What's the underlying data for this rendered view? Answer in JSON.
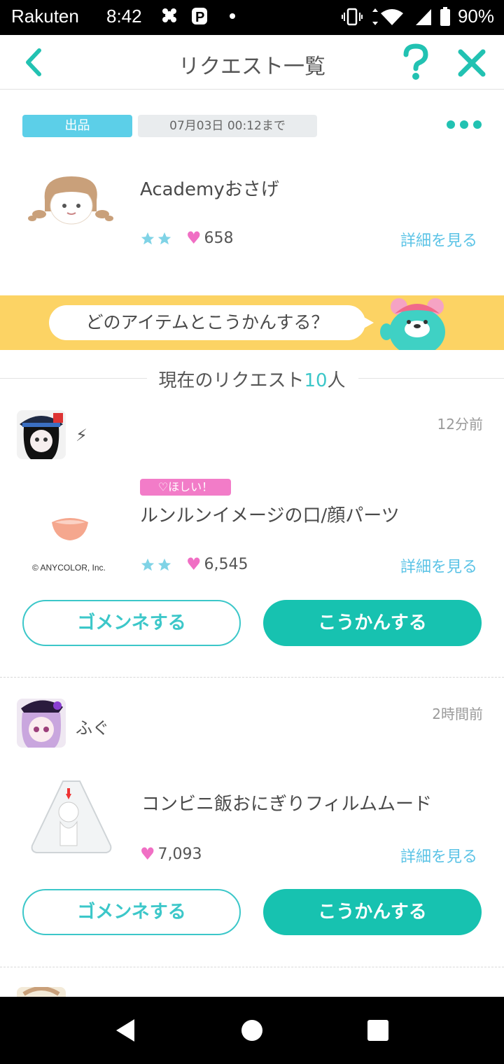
{
  "status_bar": {
    "carrier": "Rakuten",
    "time": "8:42",
    "notification_icons": [
      "flower-icon",
      "p-icon",
      "dot-icon"
    ],
    "battery": "90%"
  },
  "header": {
    "title": "リクエスト一覧"
  },
  "listing": {
    "tag": "出品",
    "deadline": "07月03日 00:12まで",
    "item_name": "Academyおさげ",
    "stars": 2,
    "likes": "658",
    "detail_label": "詳細を見る"
  },
  "banner": {
    "text": "どのアイテムとこうかんする？"
  },
  "requests_heading": {
    "prefix": "現在のリクエスト",
    "count": "10",
    "suffix": "人"
  },
  "requests": [
    {
      "username": "⚡",
      "time_ago": "12分前",
      "badge": "♡ほしい！",
      "item_name": "ルンルンイメージの口/顔パーツ",
      "stars": 2,
      "likes": "6,545",
      "copyright": "© ANYCOLOR, Inc.",
      "detail_label": "詳細を見る",
      "decline_label": "ゴメンネする",
      "accept_label": "こうかんする"
    },
    {
      "username": "ふぐ",
      "time_ago": "2時間前",
      "item_name": "コンビニ飯おにぎりフィルムムード",
      "likes": "7,093",
      "detail_label": "詳細を見る",
      "decline_label": "ゴメンネする",
      "accept_label": "こうかんする"
    }
  ],
  "colors": {
    "accent": "#3cc7c9",
    "button_fill": "#17c2b0",
    "tag_blue": "#5ccfe8",
    "banner_yellow": "#fcd364",
    "heart_pink": "#f06fc4",
    "link_blue": "#5bc3e6"
  }
}
